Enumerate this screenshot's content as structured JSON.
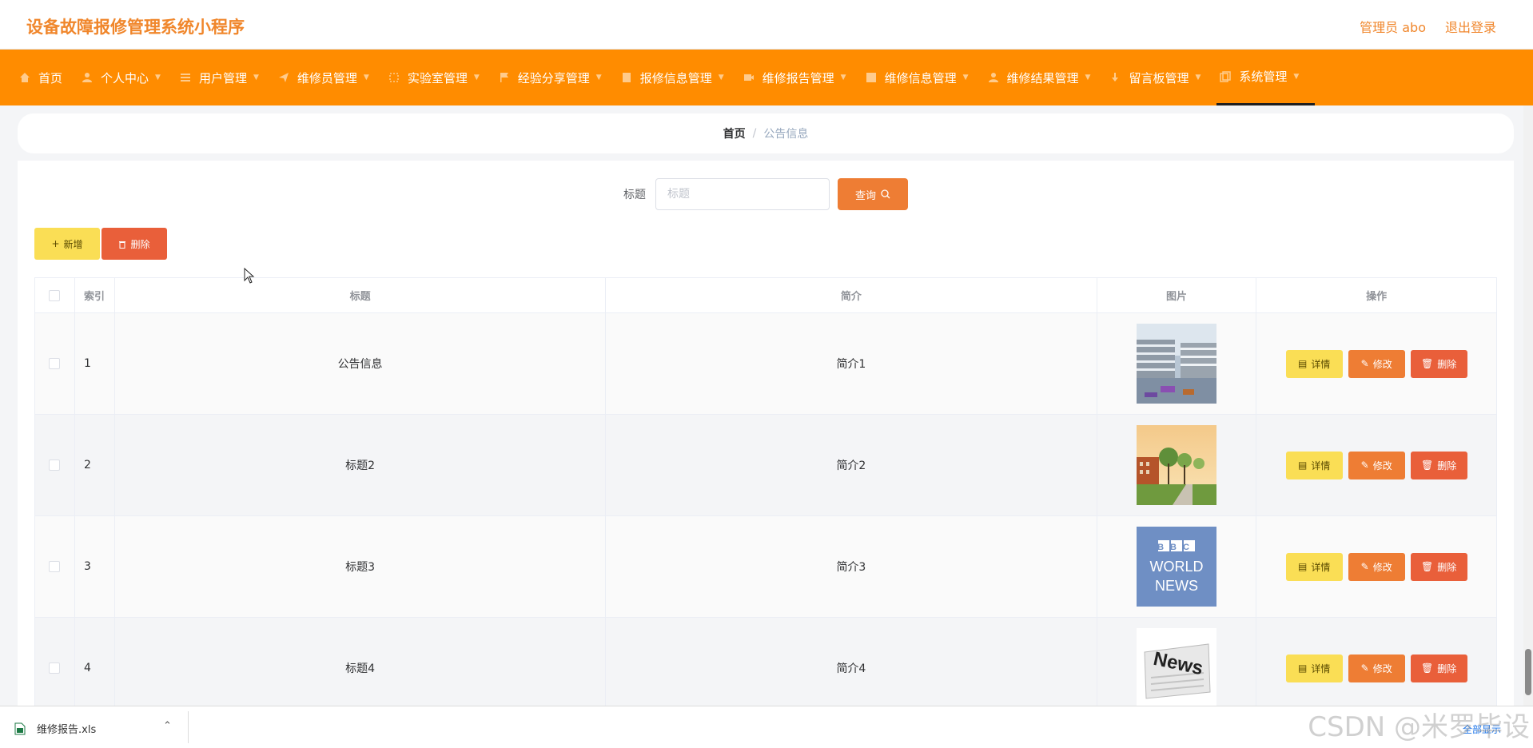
{
  "app": {
    "title": "设备故障报修管理系统小程序"
  },
  "header": {
    "user_label": "管理员 abo",
    "logout_label": "退出登录"
  },
  "nav": {
    "items": [
      {
        "label": "首页",
        "icon": "home-icon"
      },
      {
        "label": "个人中心",
        "icon": "user-icon"
      },
      {
        "label": "用户管理",
        "icon": "list-icon"
      },
      {
        "label": "维修员管理",
        "icon": "send-icon"
      },
      {
        "label": "实验室管理",
        "icon": "crop-icon"
      },
      {
        "label": "经验分享管理",
        "icon": "flag-icon"
      },
      {
        "label": "报修信息管理",
        "icon": "document-icon"
      },
      {
        "label": "维修报告管理",
        "icon": "video-icon"
      },
      {
        "label": "维修信息管理",
        "icon": "grid-icon"
      },
      {
        "label": "维修结果管理",
        "icon": "user-check-icon"
      },
      {
        "label": "留言板管理",
        "icon": "download-icon"
      },
      {
        "label": "系统管理",
        "icon": "copy-icon"
      }
    ]
  },
  "breadcrumb": {
    "home": "首页",
    "current": "公告信息"
  },
  "search": {
    "label": "标题",
    "placeholder": "标题",
    "button_label": "查询"
  },
  "actions": {
    "add_label": "新增",
    "delete_label": "删除"
  },
  "table": {
    "headers": {
      "index": "索引",
      "title": "标题",
      "desc": "简介",
      "image": "图片",
      "ops": "操作"
    },
    "ops": {
      "detail": "详情",
      "edit": "修改",
      "delete": "删除"
    },
    "rows": [
      {
        "index": "1",
        "title": "公告信息",
        "desc": "简介1",
        "image": "modern-building-photo"
      },
      {
        "index": "2",
        "title": "标题2",
        "desc": "简介2",
        "image": "campus-street-photo"
      },
      {
        "index": "3",
        "title": "标题3",
        "desc": "简介3",
        "image": "bbc-world-news-logo"
      },
      {
        "index": "4",
        "title": "标题4",
        "desc": "简介4",
        "image": "news-paper-graphic"
      }
    ]
  },
  "images": {
    "bbc": "BBC",
    "world": "WORLD",
    "news": "NEWS",
    "news_paper": "News"
  },
  "download_bar": {
    "filename": "维修报告.xls",
    "show_all": "全部显示"
  },
  "watermark": "CSDN @米罗毕设",
  "colors": {
    "accent": "#ff8c00",
    "title": "#f0862b",
    "detail": "#fade55",
    "edit": "#ee7d34",
    "delete": "#e95f3a"
  }
}
